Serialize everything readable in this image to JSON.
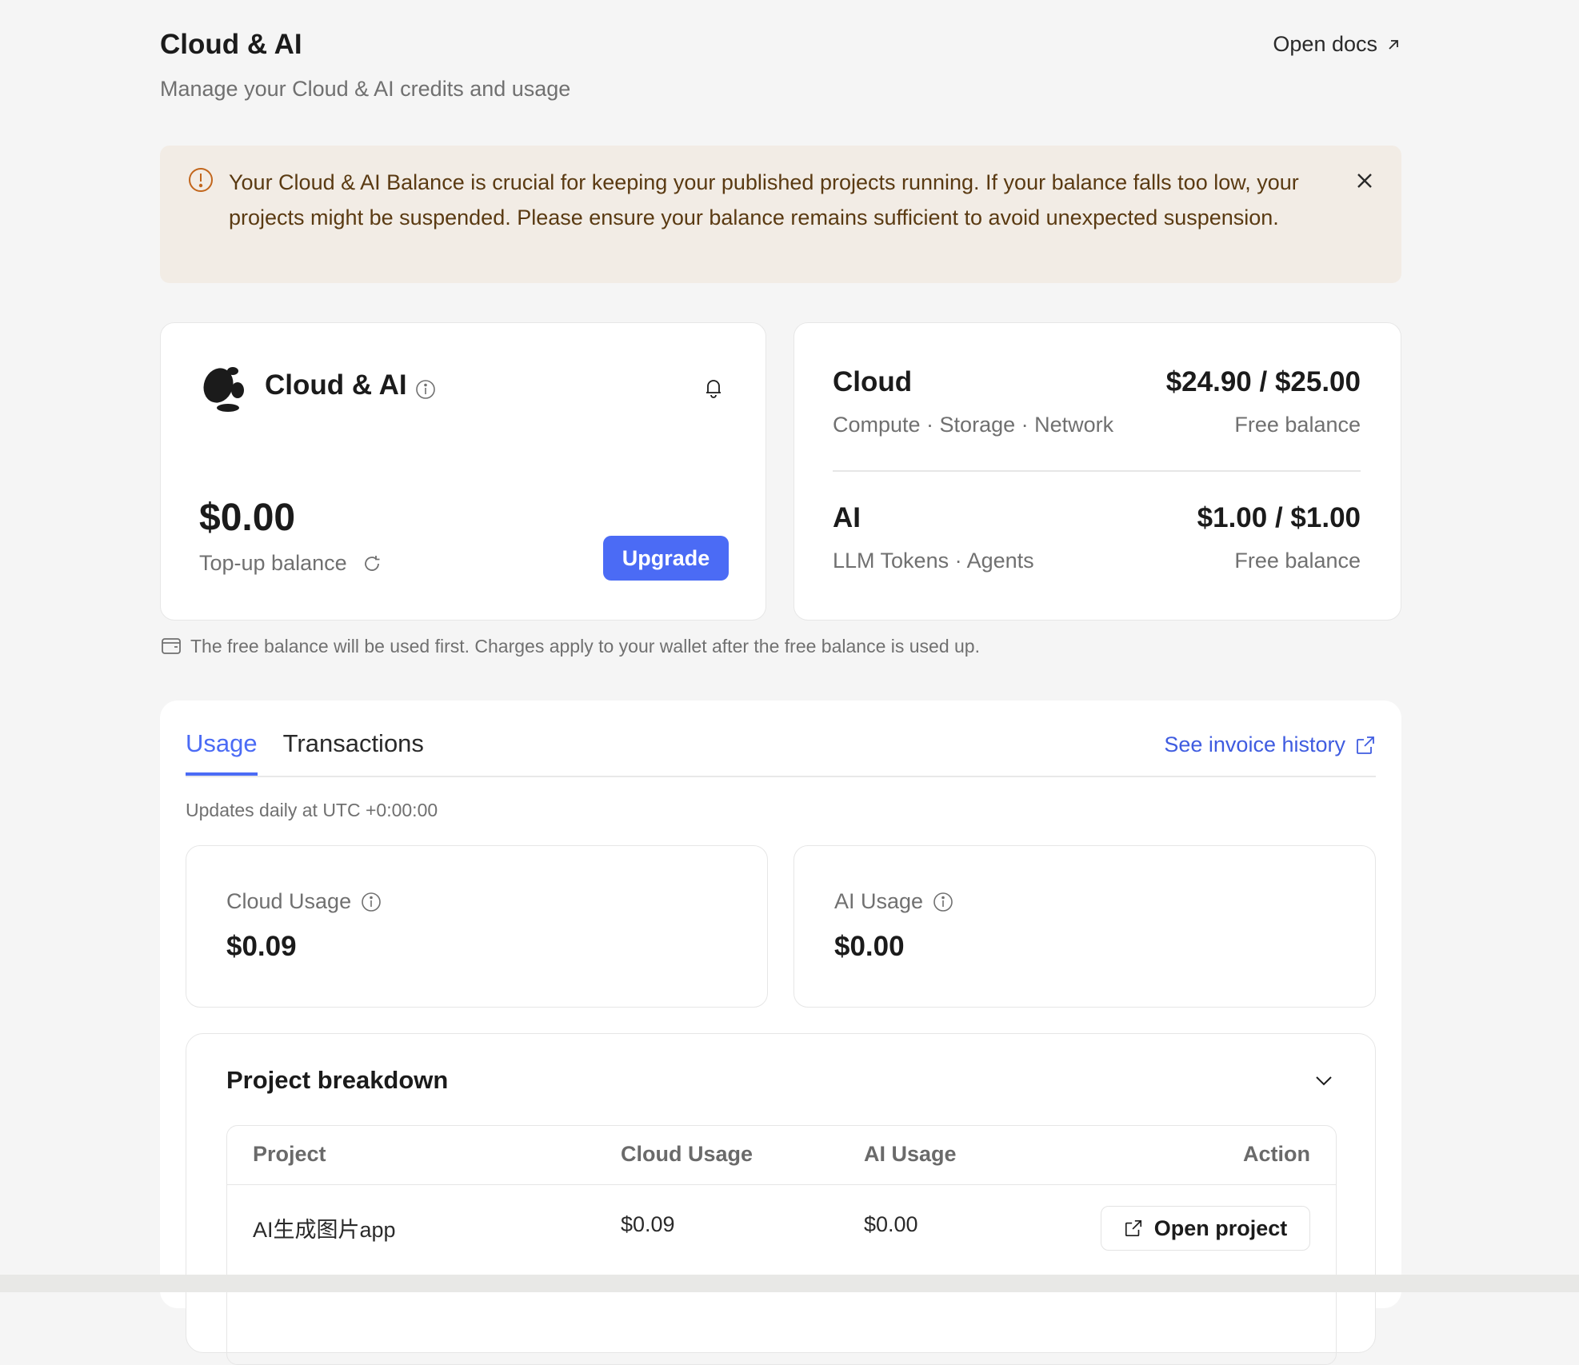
{
  "header": {
    "title": "Cloud & AI",
    "subtitle": "Manage your Cloud & AI credits and usage",
    "open_docs": "Open docs"
  },
  "alert": {
    "text": "Your Cloud & AI Balance is crucial for keeping your published projects running. If your balance falls too low, your projects might be suspended. Please ensure your balance remains sufficient to avoid unexpected suspension."
  },
  "balance_card": {
    "title": "Cloud & AI",
    "amount": "$0.00",
    "label": "Top-up balance",
    "upgrade": "Upgrade"
  },
  "free_balance": {
    "cloud": {
      "name": "Cloud",
      "amount": "$24.90 / $25.00",
      "desc": "Compute · Storage · Network",
      "label": "Free balance"
    },
    "ai": {
      "name": "AI",
      "amount": "$1.00 / $1.00",
      "desc": "LLM Tokens · Agents",
      "label": "Free balance"
    }
  },
  "note": "The free balance will be used first. Charges apply to your wallet after the free balance is used up.",
  "usage": {
    "tabs": [
      "Usage",
      "Transactions"
    ],
    "invoice_link": "See invoice history",
    "updates_note": "Updates daily at UTC +0:00:00",
    "cloud_usage_label": "Cloud Usage",
    "cloud_usage_value": "$0.09",
    "ai_usage_label": "AI Usage",
    "ai_usage_value": "$0.00"
  },
  "breakdown": {
    "title": "Project breakdown",
    "columns": [
      "Project",
      "Cloud Usage",
      "AI Usage",
      "Action"
    ],
    "rows": [
      {
        "project": "AI生成图片app",
        "cloud": "$0.09",
        "ai": "$0.00",
        "action": "Open project"
      }
    ]
  },
  "colors": {
    "accent": "#4b6bf5",
    "alert_bg": "#f2ece5",
    "alert_icon": "#c2661c"
  }
}
